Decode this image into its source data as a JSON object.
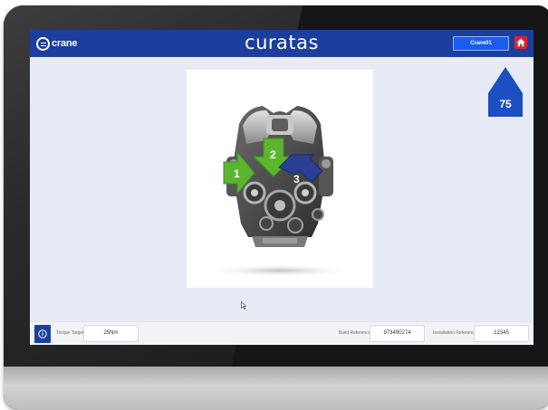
{
  "header": {
    "logo_text": "crane",
    "app_title": "curatas",
    "user_label": "Crane01"
  },
  "counter": {
    "value": "75"
  },
  "engine": {
    "arrows": [
      {
        "label": "1",
        "color": "#5cb531"
      },
      {
        "label": "2",
        "color": "#5cb531"
      },
      {
        "label": "3",
        "color": "#2a3f93"
      }
    ]
  },
  "footer": {
    "torque_label": "Torque Target",
    "torque_value": "25Nm",
    "build_label": "Build Reference",
    "build_value": "973490274",
    "install_label": "Installation Reference",
    "install_value": "12345"
  },
  "colors": {
    "header": "#1c3e9c",
    "user_button": "#1a5cf2",
    "home_button": "#d7262f",
    "counter_badge": "#1c4fc1",
    "screen_background": "#e8ebf5"
  },
  "icons": [
    "crane-logo-icon",
    "home-icon",
    "info-icon",
    "mouse-cursor-icon"
  ]
}
